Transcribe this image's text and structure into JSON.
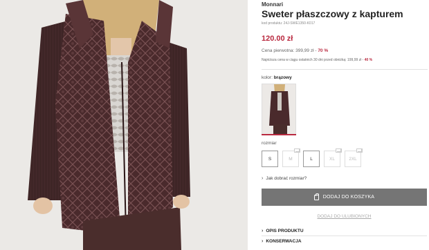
{
  "product": {
    "brand": "Monnari",
    "title": "Sweter płaszczowy z kapturem",
    "code": "kod produktu: 24J-SWE1350-K017",
    "price": "120.00 zł",
    "previous_price": {
      "label": "Cena pierwotna: 399,99 zł - ",
      "percent": "70 %"
    },
    "lowest_price": {
      "label": "Najniższa cena w ciągu ostatnich 30 dni przed obniżką: 199,99 zł - ",
      "percent": "40 %"
    }
  },
  "color": {
    "label": "kolor: ",
    "value": "brązowy",
    "accent": "#b9293f"
  },
  "sizes": {
    "label": "rozmiar",
    "options": [
      {
        "label": "S",
        "available": true
      },
      {
        "label": "M",
        "available": false
      },
      {
        "label": "L",
        "available": true
      },
      {
        "label": "XL",
        "available": false
      },
      {
        "label": "2XL",
        "available": false
      }
    ]
  },
  "size_guide": "Jak dobrać rozmiar?",
  "actions": {
    "add_to_cart": "DODAJ DO KOSZYKA",
    "add_to_favorites": "DODAJ DO ULUBIONYCH"
  },
  "accordion": [
    {
      "label": "OPIS PRODUKTU"
    },
    {
      "label": "KONSERWACJA"
    }
  ],
  "icons": {
    "bag": "shopping-bag-icon",
    "chevron": "chevron-right-icon",
    "mail": "notify-mail-icon"
  }
}
